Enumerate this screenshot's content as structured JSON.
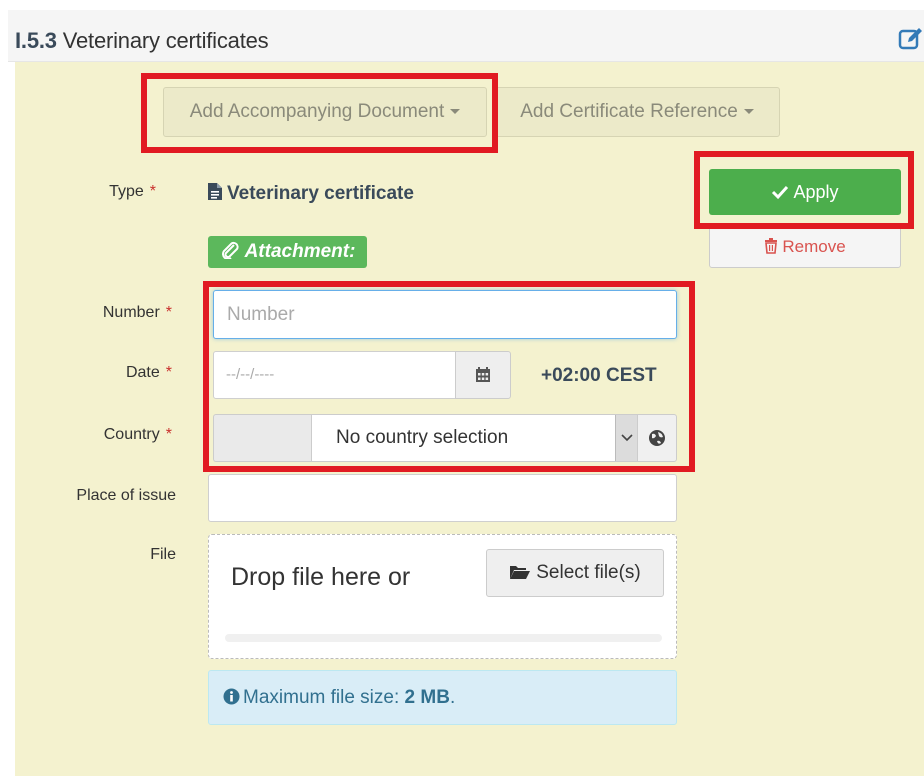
{
  "header": {
    "code": "I.5.3",
    "title": "Veterinary certificates"
  },
  "toolbar": {
    "add_document": "Add Accompanying Document",
    "add_certificate_reference": "Add Certificate Reference"
  },
  "fields": {
    "type_label": "Type",
    "type_value": "Veterinary certificate",
    "attachment_badge": "Attachment:",
    "number_label": "Number",
    "number_placeholder": "Number",
    "date_label": "Date",
    "date_placeholder": "--/--/----",
    "timezone": "+02:00 CEST",
    "country_label": "Country",
    "country_value": "No country selection",
    "place_label": "Place of issue",
    "file_label": "File",
    "required_mark": "*"
  },
  "actions": {
    "apply": "Apply",
    "remove": "Remove"
  },
  "file": {
    "drop_text": "Drop file here or",
    "select_button": "Select file(s)",
    "info_prefix": "Maximum file size:",
    "info_value": "2 MB",
    "info_suffix": "."
  },
  "icons": {
    "edit": "edit-icon",
    "document": "file-icon",
    "paperclip": "paperclip-icon",
    "check": "check-icon",
    "trash": "trash-icon",
    "calendar": "calendar-icon",
    "globe": "globe-icon",
    "folder": "folder-open-icon",
    "info": "info-icon"
  },
  "colors": {
    "panel": "#f4f2cf",
    "success": "#4cae4c",
    "danger": "#d9534f",
    "highlight": "#e11b22",
    "info_bg": "#d9edf7"
  }
}
